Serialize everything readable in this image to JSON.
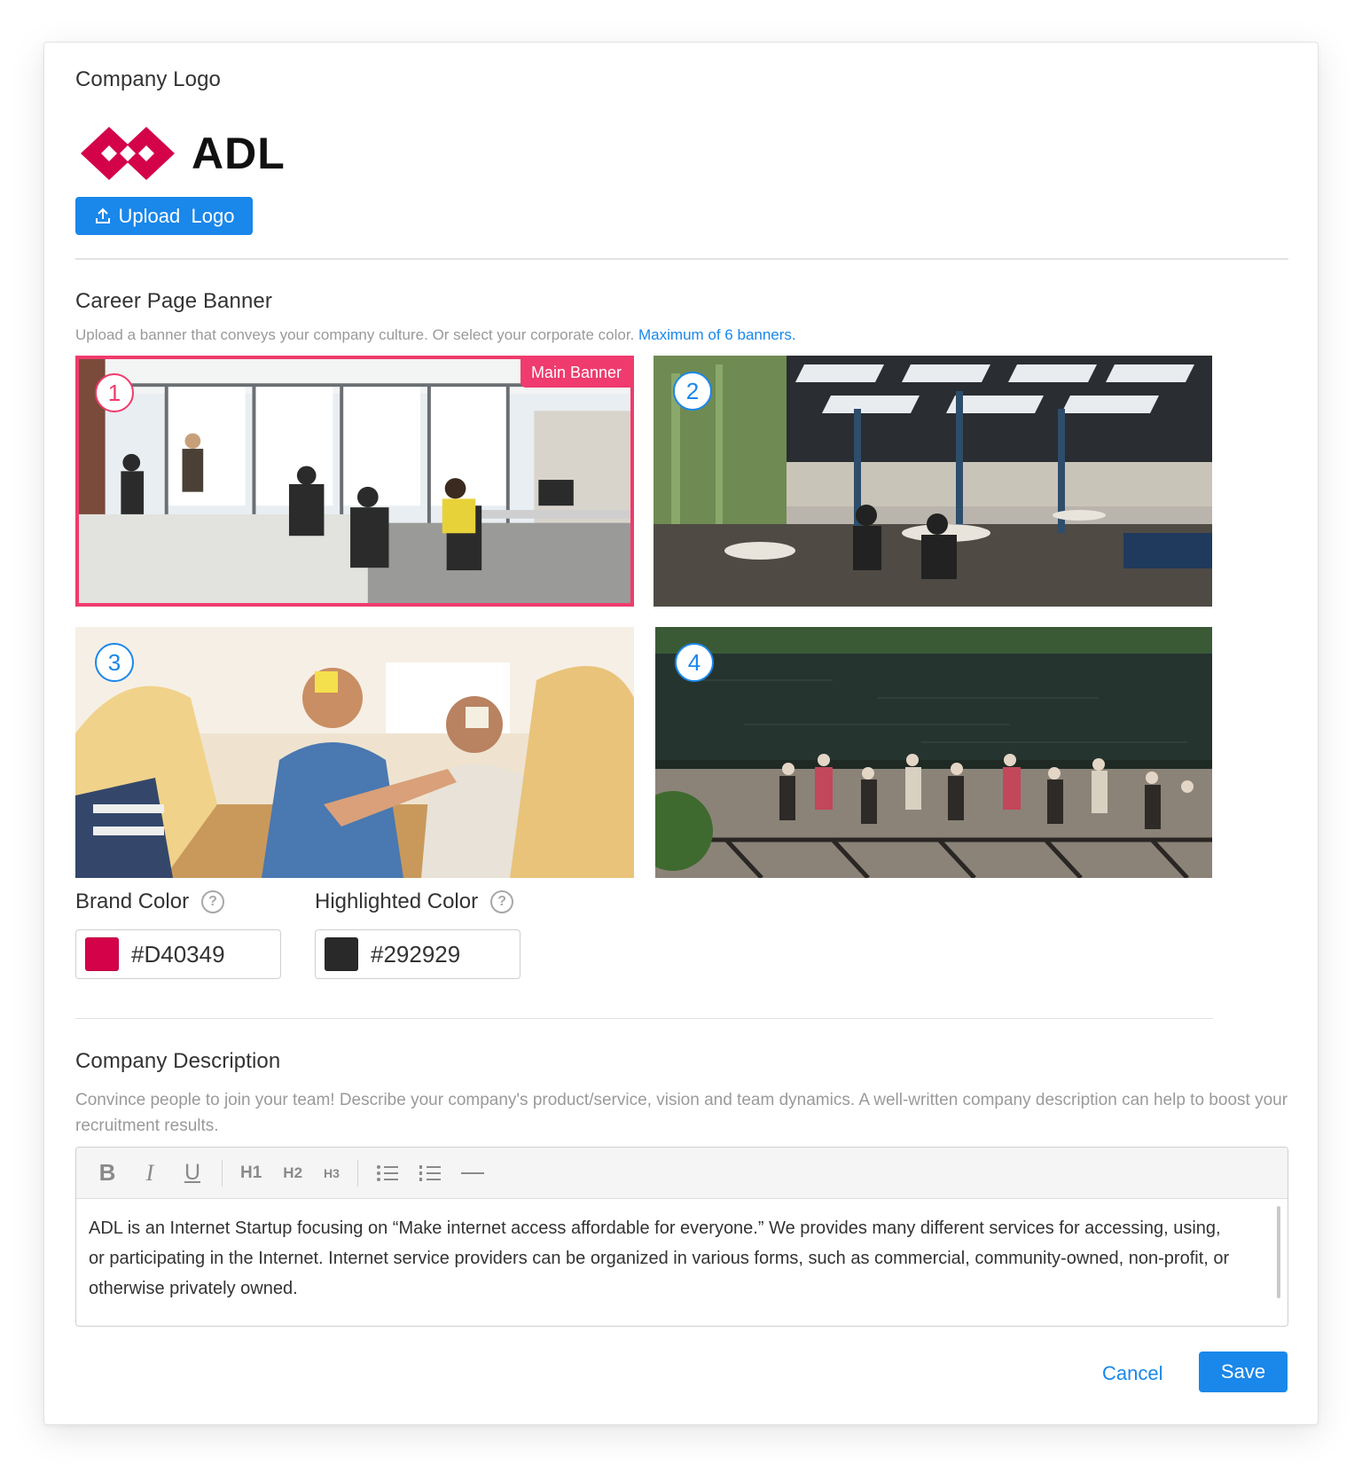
{
  "logo_section": {
    "title": "Company Logo",
    "logo_text": "ADL",
    "upload_button": "Upload  Logo"
  },
  "banner_section": {
    "title": "Career Page Banner",
    "subtitle": "Upload a banner that conveys your company culture. Or select your corporate color.",
    "subtitle_link": "Maximum of 6 banners.",
    "main_banner_tag": "Main Banner",
    "banners": [
      {
        "number": "1",
        "scene": "office-workspace",
        "is_main": true
      },
      {
        "number": "2",
        "scene": "open-cafeteria",
        "is_main": false
      },
      {
        "number": "3",
        "scene": "team-game",
        "is_main": false
      },
      {
        "number": "4",
        "scene": "lakeside-party",
        "is_main": false
      }
    ]
  },
  "colors": {
    "brand": {
      "label": "Brand Color",
      "value": "#D40349",
      "swatch": "#D40349"
    },
    "highlighted": {
      "label": "Highlighted Color",
      "value": "#292929",
      "swatch": "#292929"
    },
    "accent": "#1A87EA",
    "main_banner_border": "#EF3B6D"
  },
  "description_section": {
    "title": "Company Description",
    "help": "Convince people to join your team! Describe your company's product/service, vision and team dynamics. A well-written company description can help to boost your recruitment results.",
    "toolbar": {
      "bold_icon": "bold-icon",
      "italic_icon": "italic-icon",
      "underline_icon": "underline-icon",
      "h1": "H1",
      "h2": "H2",
      "h3": "H3",
      "bullet_icon": "bullet-list-icon",
      "numbered_icon": "numbered-list-icon",
      "rule_icon": "horizontal-rule-icon"
    },
    "body": "ADL is an Internet Startup focusing on “Make internet access affordable for everyone.” We provides many different services for accessing, using, or participating in the Internet. Internet service providers can be organized in various forms, such as commercial, community-owned, non-profit, or otherwise privately owned."
  },
  "actions": {
    "cancel": "Cancel",
    "save": "Save"
  }
}
